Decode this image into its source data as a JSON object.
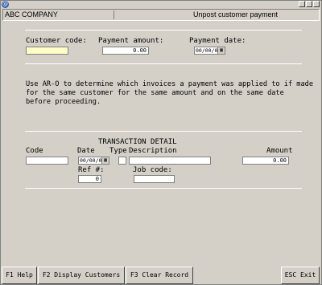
{
  "header": {
    "company": "ABC COMPANY",
    "screen_title": "Unpost customer payment"
  },
  "top_form": {
    "customer_code_label": "Customer code:",
    "customer_code_value": "",
    "payment_amount_label": "Payment amount:",
    "payment_amount_value": "0.00",
    "payment_date_label": "Payment date:",
    "payment_date_value": "00/00/00"
  },
  "info_text": "Use AR-O to determine which invoices a payment was applied to if made\nfor the same customer for the same amount and on the same date\nbefore proceeding.",
  "transaction_detail": {
    "section_title": "TRANSACTION DETAIL",
    "code_label": "Code",
    "date_label": "Date",
    "type_label": "Type",
    "description_label": "Description",
    "amount_label": "Amount",
    "date_value": "00/00/00",
    "amount_value": "0.00",
    "ref_label": "Ref #:",
    "ref_value": "0",
    "job_code_label": "Job code:",
    "job_code_value": ""
  },
  "function_keys": [
    {
      "label": "F1 Help"
    },
    {
      "label": "F2 Display Customers"
    },
    {
      "label": "F3 Clear Record"
    },
    {
      "label": "ESC Exit"
    }
  ],
  "icons": {
    "system": "app-icon",
    "calendar": "calendar-icon"
  }
}
